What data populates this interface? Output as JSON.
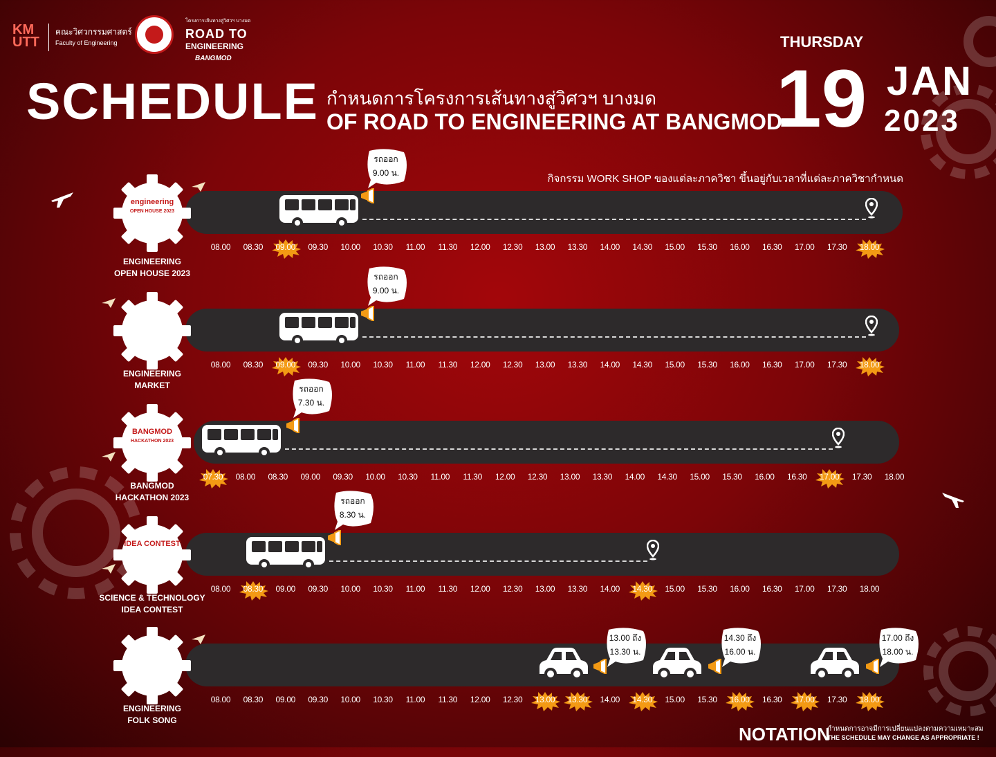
{
  "header": {
    "kmutt": "KMUTT",
    "faculty_th": "คณะวิศวกรรมศาสตร์",
    "faculty_en": "Faculty of Engineering",
    "rte_small": "โครงการเส้นทางสู่วิศวฯ บางมด",
    "rte_line1": "ROAD TO",
    "rte_line2": "ENGINEERING",
    "rte_line3": "BANGMOD",
    "title": "SCHEDULE",
    "subtitle_th": "กำหนดการโครงการเส้นทางสู่วิศวฯ บางมด",
    "subtitle_en": "OF ROAD TO ENGINEERING AT BANGMOD",
    "day_of_week": "THURSDAY",
    "day": "19",
    "month": "JAN",
    "year": "2023",
    "workshop_note": "กิจกรรม WORK SHOP ของแต่ละภาควิชา ขึ้นอยู่กับเวลาที่แต่ละภาควิชากำหนด"
  },
  "rows": [
    {
      "label_line1": "ENGINEERING",
      "label_line2": "OPEN HOUSE 2023",
      "gear_icon": "open-house-logo-icon",
      "gear_text": "engineering",
      "gear_sub": "OPEN HOUSE 2023",
      "times": [
        "08.00",
        "08.30",
        "09.00",
        "09.30",
        "10.00",
        "10.30",
        "11.00",
        "11.30",
        "12.00",
        "12.30",
        "13.00",
        "13.30",
        "14.00",
        "14.30",
        "15.00",
        "15.30",
        "16.00",
        "16.30",
        "17.00",
        "17.30",
        "18.00"
      ],
      "highlight": [
        "09.00",
        "18.00"
      ],
      "vehicle": "bus",
      "departure_bubble": [
        "รถออก",
        "9.00 น."
      ]
    },
    {
      "label_line1": "ENGINEERING",
      "label_line2": "MARKET",
      "gear_icon": "market-stall-icon",
      "times": [
        "08.00",
        "08.30",
        "09.00",
        "09.30",
        "10.00",
        "10.30",
        "11.00",
        "11.30",
        "12.00",
        "12.30",
        "13.00",
        "13.30",
        "14.00",
        "14.30",
        "15.00",
        "15.30",
        "16.00",
        "16.30",
        "17.00",
        "17.30",
        "18.00"
      ],
      "highlight": [
        "09.00",
        "18.00"
      ],
      "vehicle": "bus",
      "departure_bubble": [
        "รถออก",
        "9.00 น."
      ]
    },
    {
      "label_line1": "BANGMOD",
      "label_line2": "HACKATHON 2023",
      "gear_icon": "hackathon-logo-icon",
      "gear_text": "BANGMOD",
      "gear_sub": "HACKATHON 2023",
      "times": [
        "07.30",
        "08.00",
        "08.30",
        "09.00",
        "09.30",
        "10.00",
        "10.30",
        "11.00",
        "11.30",
        "12.00",
        "12.30",
        "13.00",
        "13.30",
        "14.00",
        "14.30",
        "15.00",
        "15.30",
        "16.00",
        "16.30",
        "17.00",
        "17.30",
        "18.00"
      ],
      "highlight": [
        "07.30",
        "17.00"
      ],
      "vehicle": "bus",
      "departure_bubble": [
        "รถออก",
        "7.30 น."
      ]
    },
    {
      "label_line1": "SCIENCE & TECHNOLOGY",
      "label_line2": "IDEA CONTEST",
      "gear_icon": "idea-contest-logo-icon",
      "gear_text": "IDEA CONTEST",
      "times": [
        "08.00",
        "08.30",
        "09.00",
        "09.30",
        "10.00",
        "10.30",
        "11.00",
        "11.30",
        "12.00",
        "12.30",
        "13.00",
        "13.30",
        "14.00",
        "14.30",
        "15.00",
        "15.30",
        "16.00",
        "16.30",
        "17.00",
        "17.30",
        "18.00"
      ],
      "highlight": [
        "08.30",
        "14.30"
      ],
      "vehicle": "bus",
      "departure_bubble": [
        "รถออก",
        "8.30 น."
      ]
    },
    {
      "label_line1": "ENGINEERING",
      "label_line2": "FOLK SONG",
      "gear_icon": "music-note-icon",
      "times": [
        "08.00",
        "08.30",
        "09.00",
        "09.30",
        "10.00",
        "10.30",
        "11.00",
        "11.30",
        "12.00",
        "12.30",
        "13.00",
        "13.30",
        "14.00",
        "14.30",
        "15.00",
        "15.30",
        "16.00",
        "16.30",
        "17.00",
        "17.30",
        "18.00"
      ],
      "highlight": [
        "13.00",
        "13.30",
        "14.30",
        "16.00",
        "17.00",
        "18.00"
      ],
      "vehicle": "car",
      "car_bubbles": [
        [
          "13.00 ถึง",
          "13.30 น."
        ],
        [
          "14.30 ถึง",
          "16.00 น."
        ],
        [
          "17.00 ถึง",
          "18.00 น."
        ]
      ]
    }
  ],
  "notation": {
    "title": "NOTATION",
    "text_th": "กำหนดการอาจมีการเปลี่ยนแปลงตามความเหมาะสม",
    "text_en": "THE SCHEDULE MAY CHANGE AS APPROPRIATE !"
  },
  "colors": {
    "road": "#2d2a2b",
    "splat": "#f39a14",
    "background": "#8c0507"
  }
}
